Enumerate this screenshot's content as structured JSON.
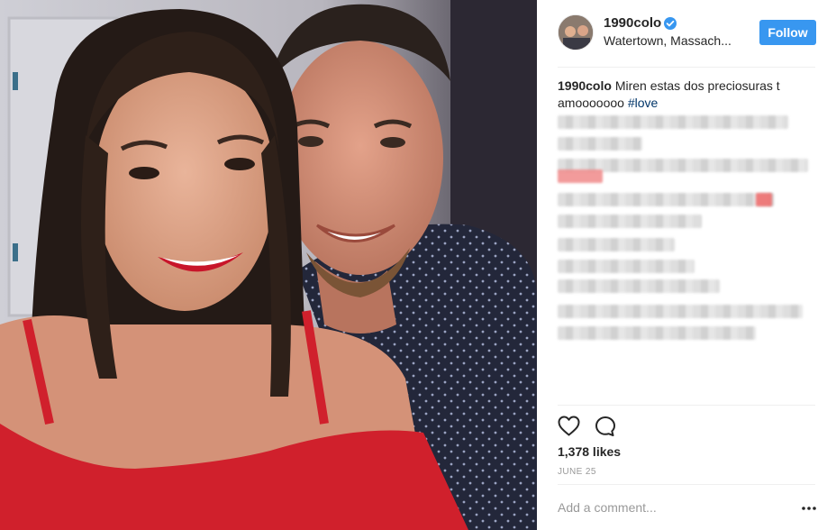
{
  "post": {
    "username": "1990colo",
    "location": "Watertown, Massach...",
    "follow_label": "Follow",
    "caption_username": "1990colo",
    "caption_text": "Miren estas dos preciosuras t amooooooo",
    "caption_hashtag": "#love",
    "likes": "1,378 likes",
    "date": "JUNE 25",
    "comment_placeholder": "Add a comment..."
  },
  "icons": {
    "verified": "verified-badge-icon",
    "heart": "heart-icon",
    "comment": "comment-icon",
    "more": "more-options-icon"
  },
  "colors": {
    "follow_button": "#3897f0",
    "hashtag": "#003569",
    "verified_badge": "#3897f0"
  }
}
